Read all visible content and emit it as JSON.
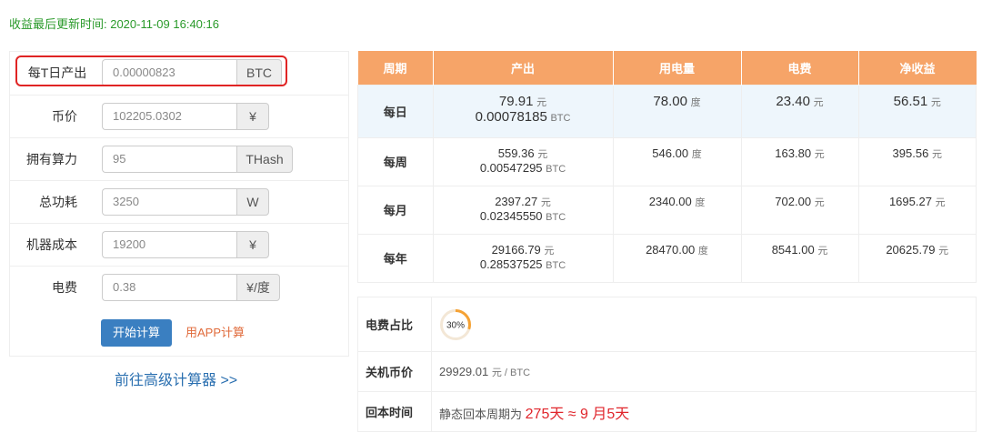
{
  "update_text": "收益最后更新时间: 2020-11-09 16:40:16",
  "form": {
    "fields": [
      {
        "label": "每T日产出",
        "value": "0.00000823",
        "unit": "BTC"
      },
      {
        "label": "币价",
        "value": "102205.0302",
        "unit": "¥"
      },
      {
        "label": "拥有算力",
        "value": "95",
        "unit": "THash"
      },
      {
        "label": "总功耗",
        "value": "3250",
        "unit": "W"
      },
      {
        "label": "机器成本",
        "value": "19200",
        "unit": "¥"
      },
      {
        "label": "电费",
        "value": "0.38",
        "unit": "¥/度"
      }
    ],
    "calc_button": "开始计算",
    "app_link": "用APP计算",
    "advanced_link": "前往高级计算器 >>"
  },
  "result_table": {
    "headers": [
      "周期",
      "产出",
      "用电量",
      "电费",
      "净收益"
    ],
    "rows": [
      {
        "period": "每日",
        "cny": "79.91",
        "btc": "0.00078185",
        "power": "78.00",
        "fee": "23.40",
        "net": "56.51"
      },
      {
        "period": "每周",
        "cny": "559.36",
        "btc": "0.00547295",
        "power": "546.00",
        "fee": "163.80",
        "net": "395.56"
      },
      {
        "period": "每月",
        "cny": "2397.27",
        "btc": "0.02345550",
        "power": "2340.00",
        "fee": "702.00",
        "net": "1695.27"
      },
      {
        "period": "每年",
        "cny": "29166.79",
        "btc": "0.28537525",
        "power": "28470.00",
        "fee": "8541.00",
        "net": "20625.79"
      }
    ],
    "unit_yuan": "元",
    "unit_btc": "BTC",
    "unit_du": "度"
  },
  "bottom": {
    "fee_ratio_label": "电费占比",
    "fee_ratio_value": "30%",
    "fee_ratio_fraction": 0.3,
    "shutdown_label": "关机币价",
    "shutdown_value": "29929.01",
    "shutdown_unit": "元 / BTC",
    "payback_label": "回本时间",
    "payback_prefix": "静态回本周期为",
    "payback_value": "275天 ≈ 9 月5天"
  },
  "colors": {
    "header_bg": "#f6a468",
    "highlight": "#e02424",
    "ring": "#f5a235",
    "button": "#3a7fc1"
  }
}
